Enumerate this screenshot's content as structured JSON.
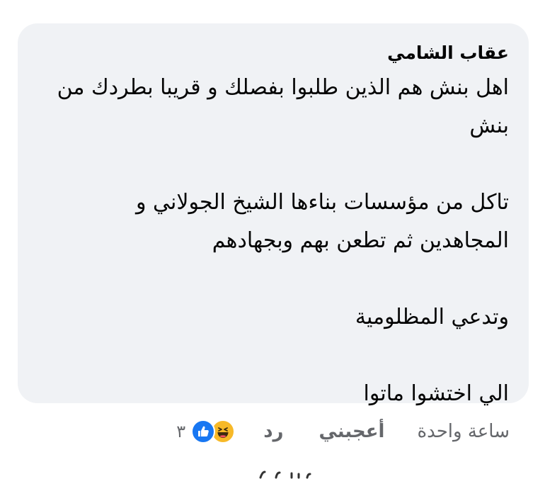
{
  "comment": {
    "author": "عقاب الشامي",
    "paragraphs": [
      "اهل بنش هم الذين طلبوا بفصلك و قريبا بطردك من بنش",
      "تاكل من مؤسسات بناءها الشيخ الجولاني و المجاهدين ثم تطعن بهم وبجهادهم",
      "وتدعي المظلومية",
      "الي اختشوا ماتوا"
    ]
  },
  "actions": {
    "timestamp": "ساعة واحدة",
    "like_label": "أعجبني",
    "reply_label": "رد",
    "reaction_count": "٣",
    "reaction_icons": [
      "like-icon",
      "haha-icon"
    ]
  },
  "colors": {
    "bubble_background": "#f0f2f5",
    "text": "#050505",
    "secondary_text": "#65676b",
    "like_blue": "#1877f2",
    "haha_yellow": "#f7b928"
  }
}
